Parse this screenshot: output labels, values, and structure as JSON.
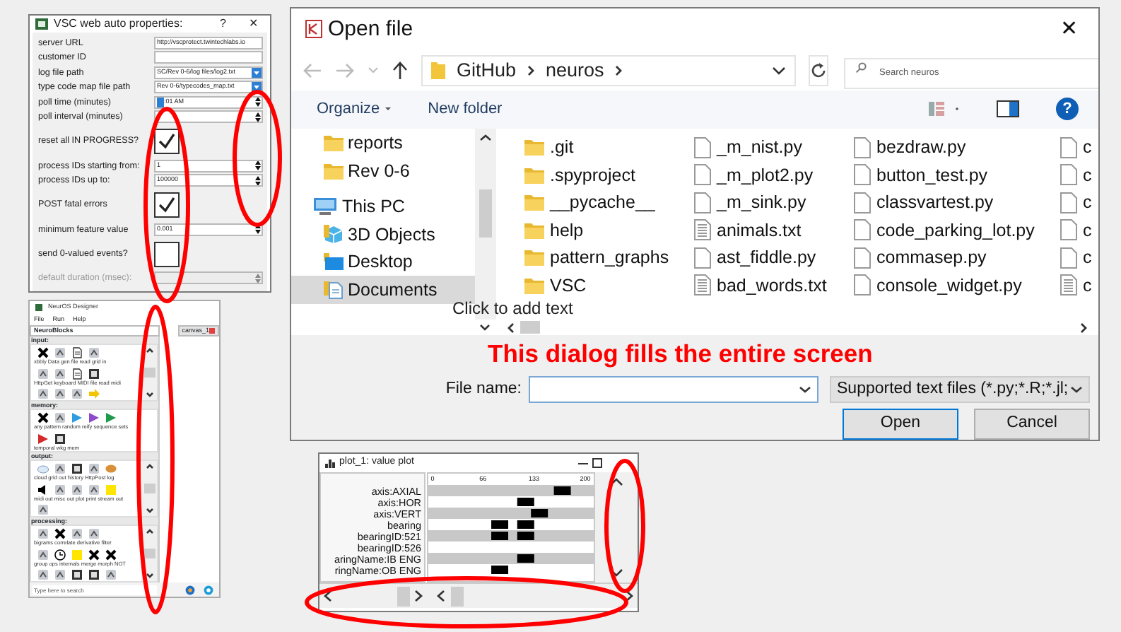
{
  "properties_dialog": {
    "title": "VSC web auto properties:",
    "help": "?",
    "close": "✕",
    "fields": [
      {
        "label": "server URL",
        "kind": "text",
        "value": "http://vscprotect.twintechlabs.io",
        "disabled": false
      },
      {
        "label": "customer ID",
        "kind": "text",
        "disabled": false
      },
      {
        "label": "log file path",
        "kind": "dropdown",
        "value": "SC/Rev 0-6/log files/log2.txt",
        "disabled": false
      },
      {
        "label": "type code map file path",
        "kind": "dropdown",
        "value": "Rev 0-6/typecodes_map.txt",
        "disabled": false
      },
      {
        "label": "poll time (minutes)",
        "kind": "time",
        "value": ":01 AM",
        "disabled": false
      },
      {
        "label": "poll interval (minutes)",
        "kind": "spin",
        "disabled": false
      },
      {
        "label": "reset all IN PROGRESS?",
        "kind": "checkbox",
        "checked": true,
        "disabled": false
      },
      {
        "label": "process IDs starting from:",
        "kind": "spin",
        "value": "1",
        "disabled": false
      },
      {
        "label": "process IDs up to:",
        "kind": "spin",
        "value": "100000",
        "disabled": false
      },
      {
        "label": "POST fatal errors",
        "kind": "checkbox",
        "checked": true,
        "disabled": false
      },
      {
        "label": "minimum feature value",
        "kind": "spin",
        "value": "0.001",
        "disabled": false
      },
      {
        "label": "send 0-valued events?",
        "kind": "checkbox",
        "checked": false,
        "disabled": false
      },
      {
        "label": "default duration (msec):",
        "kind": "spin",
        "disabled": true
      }
    ]
  },
  "designer": {
    "title": "NeurOS Designer",
    "menu": [
      "File",
      "Run",
      "Help"
    ],
    "tabs": [
      {
        "label": "NeuroBlocks",
        "selected": true
      },
      {
        "label": "canvas_1",
        "selected": false
      }
    ],
    "sections": [
      {
        "title": "input:",
        "scrollbar": true,
        "rows": [
          {
            "icons": [
              {
                "kind": "cross"
              },
              {
                "kind": "glyph"
              },
              {
                "kind": "doc"
              },
              {
                "kind": "glyph"
              }
            ],
            "labels": "xbbly Data gen file read grid in"
          },
          {
            "icons": [
              {
                "kind": "glyph"
              },
              {
                "kind": "glyph"
              },
              {
                "kind": "doc"
              },
              {
                "kind": "chip"
              }
            ],
            "labels": "HttpGet keyboard MIDI file read midi"
          },
          {
            "icons": [
              {
                "kind": "glyph"
              },
              {
                "kind": "glyph"
              },
              {
                "kind": "glyph"
              },
              {
                "kind": "arrow",
                "color": "#f5c400"
              }
            ]
          }
        ]
      },
      {
        "title": "memory:",
        "scrollbar": false,
        "rows": [
          {
            "icons": [
              {
                "kind": "cross"
              },
              {
                "kind": "glyph"
              },
              {
                "kind": "tri",
                "color": "#2f9be0"
              },
              {
                "kind": "tri",
                "color": "#8a4cc8"
              },
              {
                "kind": "tri",
                "color": "#1f9a4a"
              }
            ],
            "labels": "any pattern random reify sequence sets"
          },
          {
            "icons": [
              {
                "kind": "tri",
                "color": "#d42a2a"
              },
              {
                "kind": "chip"
              }
            ],
            "labels": "temporal wkg mem"
          }
        ]
      },
      {
        "title": "output:",
        "scrollbar": true,
        "rows": [
          {
            "icons": [
              {
                "kind": "cloud"
              },
              {
                "kind": "glyph"
              },
              {
                "kind": "chip"
              },
              {
                "kind": "glyph"
              },
              {
                "kind": "blob",
                "color": "#d9903a"
              }
            ],
            "labels": "cloud grid out history HttpPost log"
          },
          {
            "icons": [
              {
                "kind": "speaker"
              },
              {
                "kind": "glyph"
              },
              {
                "kind": "glyph"
              },
              {
                "kind": "glyph"
              },
              {
                "kind": "square",
                "color": "#ffe600"
              }
            ],
            "labels": "midi out misc out plot print stream out"
          },
          {
            "icons": [
              {
                "kind": "glyph"
              }
            ]
          }
        ]
      },
      {
        "title": "processing:",
        "scrollbar": true,
        "rows": [
          {
            "icons": [
              {
                "kind": "glyph"
              },
              {
                "kind": "cross"
              },
              {
                "kind": "glyph"
              },
              {
                "kind": "glyph"
              }
            ],
            "labels": "bigrams correlate derivative filter"
          },
          {
            "icons": [
              {
                "kind": "glyph"
              },
              {
                "kind": "clock"
              },
              {
                "kind": "square",
                "color": "#ffe600"
              },
              {
                "kind": "cross"
              },
              {
                "kind": "cross"
              }
            ],
            "labels": "group ops internals merge morph NOT"
          },
          {
            "icons": [
              {
                "kind": "glyph"
              },
              {
                "kind": "glyph"
              },
              {
                "kind": "chip"
              },
              {
                "kind": "chip"
              },
              {
                "kind": "glyph"
              }
            ]
          }
        ]
      }
    ],
    "taskbar": {
      "placeholder": "Type here to search"
    }
  },
  "open_dialog": {
    "title": "Open file",
    "close": "✕",
    "path": [
      "GitHub",
      "neuros"
    ],
    "search": {
      "placeholder": "Search neuros"
    },
    "toolbar": [
      "Organize",
      "New folder"
    ],
    "help": "?",
    "sidebar": [
      {
        "label": "reports",
        "kind": "folder",
        "selected": false
      },
      {
        "label": "Rev 0-6",
        "kind": "folder",
        "selected": false
      },
      {
        "label": "This PC",
        "kind": "pc",
        "selected": false
      },
      {
        "label": "3D Objects",
        "kind": "objects",
        "selected": false
      },
      {
        "label": "Desktop",
        "kind": "desktop",
        "selected": false
      },
      {
        "label": "Documents",
        "kind": "documents",
        "selected": true
      }
    ],
    "file_columns": [
      {
        "files": [
          {
            "name": ".git",
            "kind": "folder"
          },
          {
            "name": ".spyproject",
            "kind": "folder"
          },
          {
            "name": "__pycache__",
            "kind": "folder"
          },
          {
            "name": "help",
            "kind": "folder"
          },
          {
            "name": "pattern_graphs",
            "kind": "folder"
          },
          {
            "name": "VSC",
            "kind": "folder"
          }
        ]
      },
      {
        "files": [
          {
            "name": "_m_nist.py",
            "kind": "py"
          },
          {
            "name": "_m_plot2.py",
            "kind": "py"
          },
          {
            "name": "_m_sink.py",
            "kind": "py"
          },
          {
            "name": "animals.txt",
            "kind": "txt"
          },
          {
            "name": "ast_fiddle.py",
            "kind": "py"
          },
          {
            "name": "bad_words.txt",
            "kind": "txt"
          }
        ]
      },
      {
        "files": [
          {
            "name": "bezdraw.py",
            "kind": "py"
          },
          {
            "name": "button_test.py",
            "kind": "py"
          },
          {
            "name": "classvartest.py",
            "kind": "py"
          },
          {
            "name": "code_parking_lot.py",
            "kind": "py"
          },
          {
            "name": "commasep.py",
            "kind": "py"
          },
          {
            "name": "console_widget.py",
            "kind": "py"
          }
        ]
      },
      {
        "files": [
          {
            "name": "c",
            "kind": "py"
          },
          {
            "name": "c",
            "kind": "py"
          },
          {
            "name": "c",
            "kind": "py"
          },
          {
            "name": "c",
            "kind": "py"
          },
          {
            "name": "c",
            "kind": "py"
          },
          {
            "name": "c",
            "kind": "txt"
          }
        ]
      }
    ],
    "file_name": {
      "label": "File name:"
    },
    "file_type": "Supported text files (*.py;*.R;*.jl;",
    "buttons": [
      {
        "label": "Open",
        "default": true
      },
      {
        "label": "Cancel",
        "default": false
      }
    ]
  },
  "plot_window": {
    "title": "plot_1: value plot",
    "chart_data": {
      "type": "scatter",
      "orientation": "horizontal",
      "xlim": [
        0,
        200
      ],
      "xticks": [
        0,
        66,
        133,
        200
      ],
      "categories": [
        "axis:AXIAL",
        "axis:HOR",
        "axis:VERT",
        "bearing",
        "bearingID:521",
        "bearingID:526",
        "aringName:IB ENG",
        "ringName:OB ENG"
      ],
      "series": [
        {
          "color": "#000000",
          "values": [
            170,
            122,
            140,
            88,
            88,
            null,
            122,
            88
          ]
        },
        {
          "color": "#000000",
          "values": [
            null,
            null,
            null,
            122,
            122,
            null,
            null,
            null
          ]
        }
      ]
    }
  },
  "slide": {
    "caption": "This dialog fills the entire screen",
    "placeholder": "Click to add text"
  }
}
